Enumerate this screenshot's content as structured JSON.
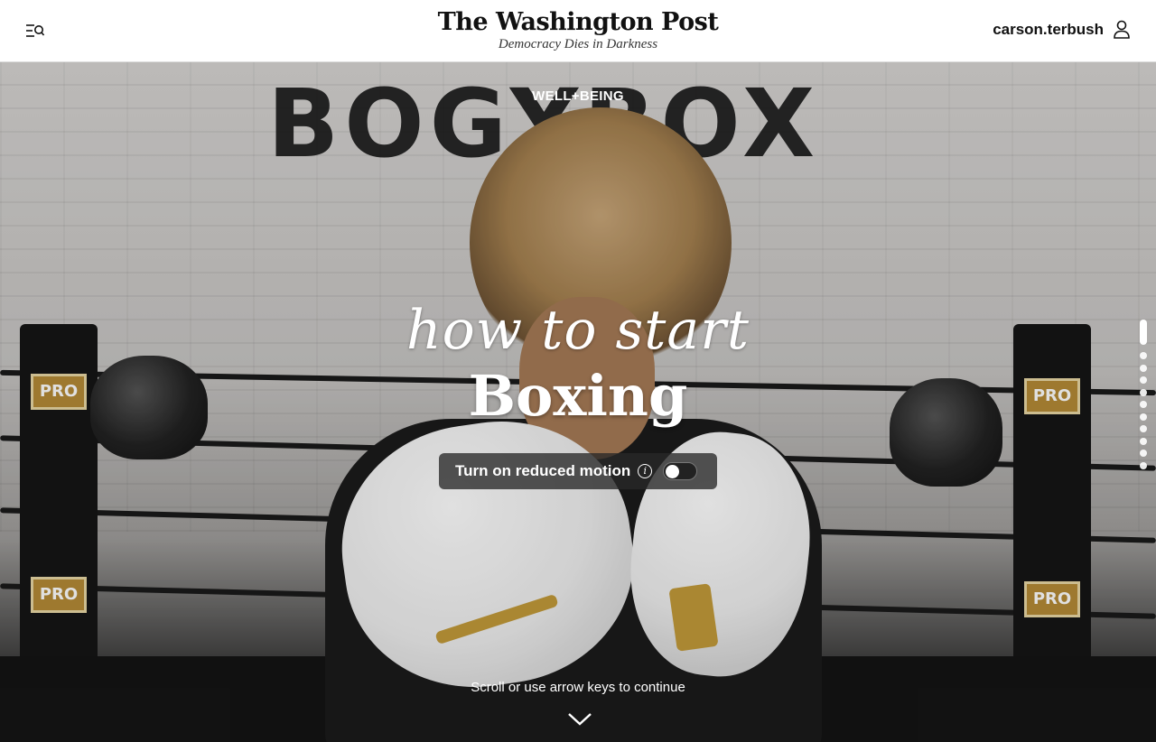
{
  "header": {
    "menu_icon": "menu-search-icon",
    "masthead_name": "The Washington Post",
    "masthead_tagline": "Democracy Dies in Darkness",
    "username": "carson.terbush",
    "user_icon": "user-icon"
  },
  "hero": {
    "section_label": "WELL+BEING",
    "wall_sign_text": "BOGYBOX",
    "script_title": "how to start",
    "title": "Boxing",
    "reduced_motion": {
      "label": "Turn on reduced motion",
      "info_icon": "info-icon",
      "enabled": false
    },
    "scroll_hint": "Scroll or use arrow keys to continue",
    "scroll_icon": "chevron-down-icon",
    "post_badge_text": "PRO",
    "progress": {
      "current": 1,
      "total": 11
    }
  },
  "colors": {
    "overlay_text": "#ffffff",
    "toggle_bg": "#282828",
    "glove_trim": "#c29a3a"
  }
}
